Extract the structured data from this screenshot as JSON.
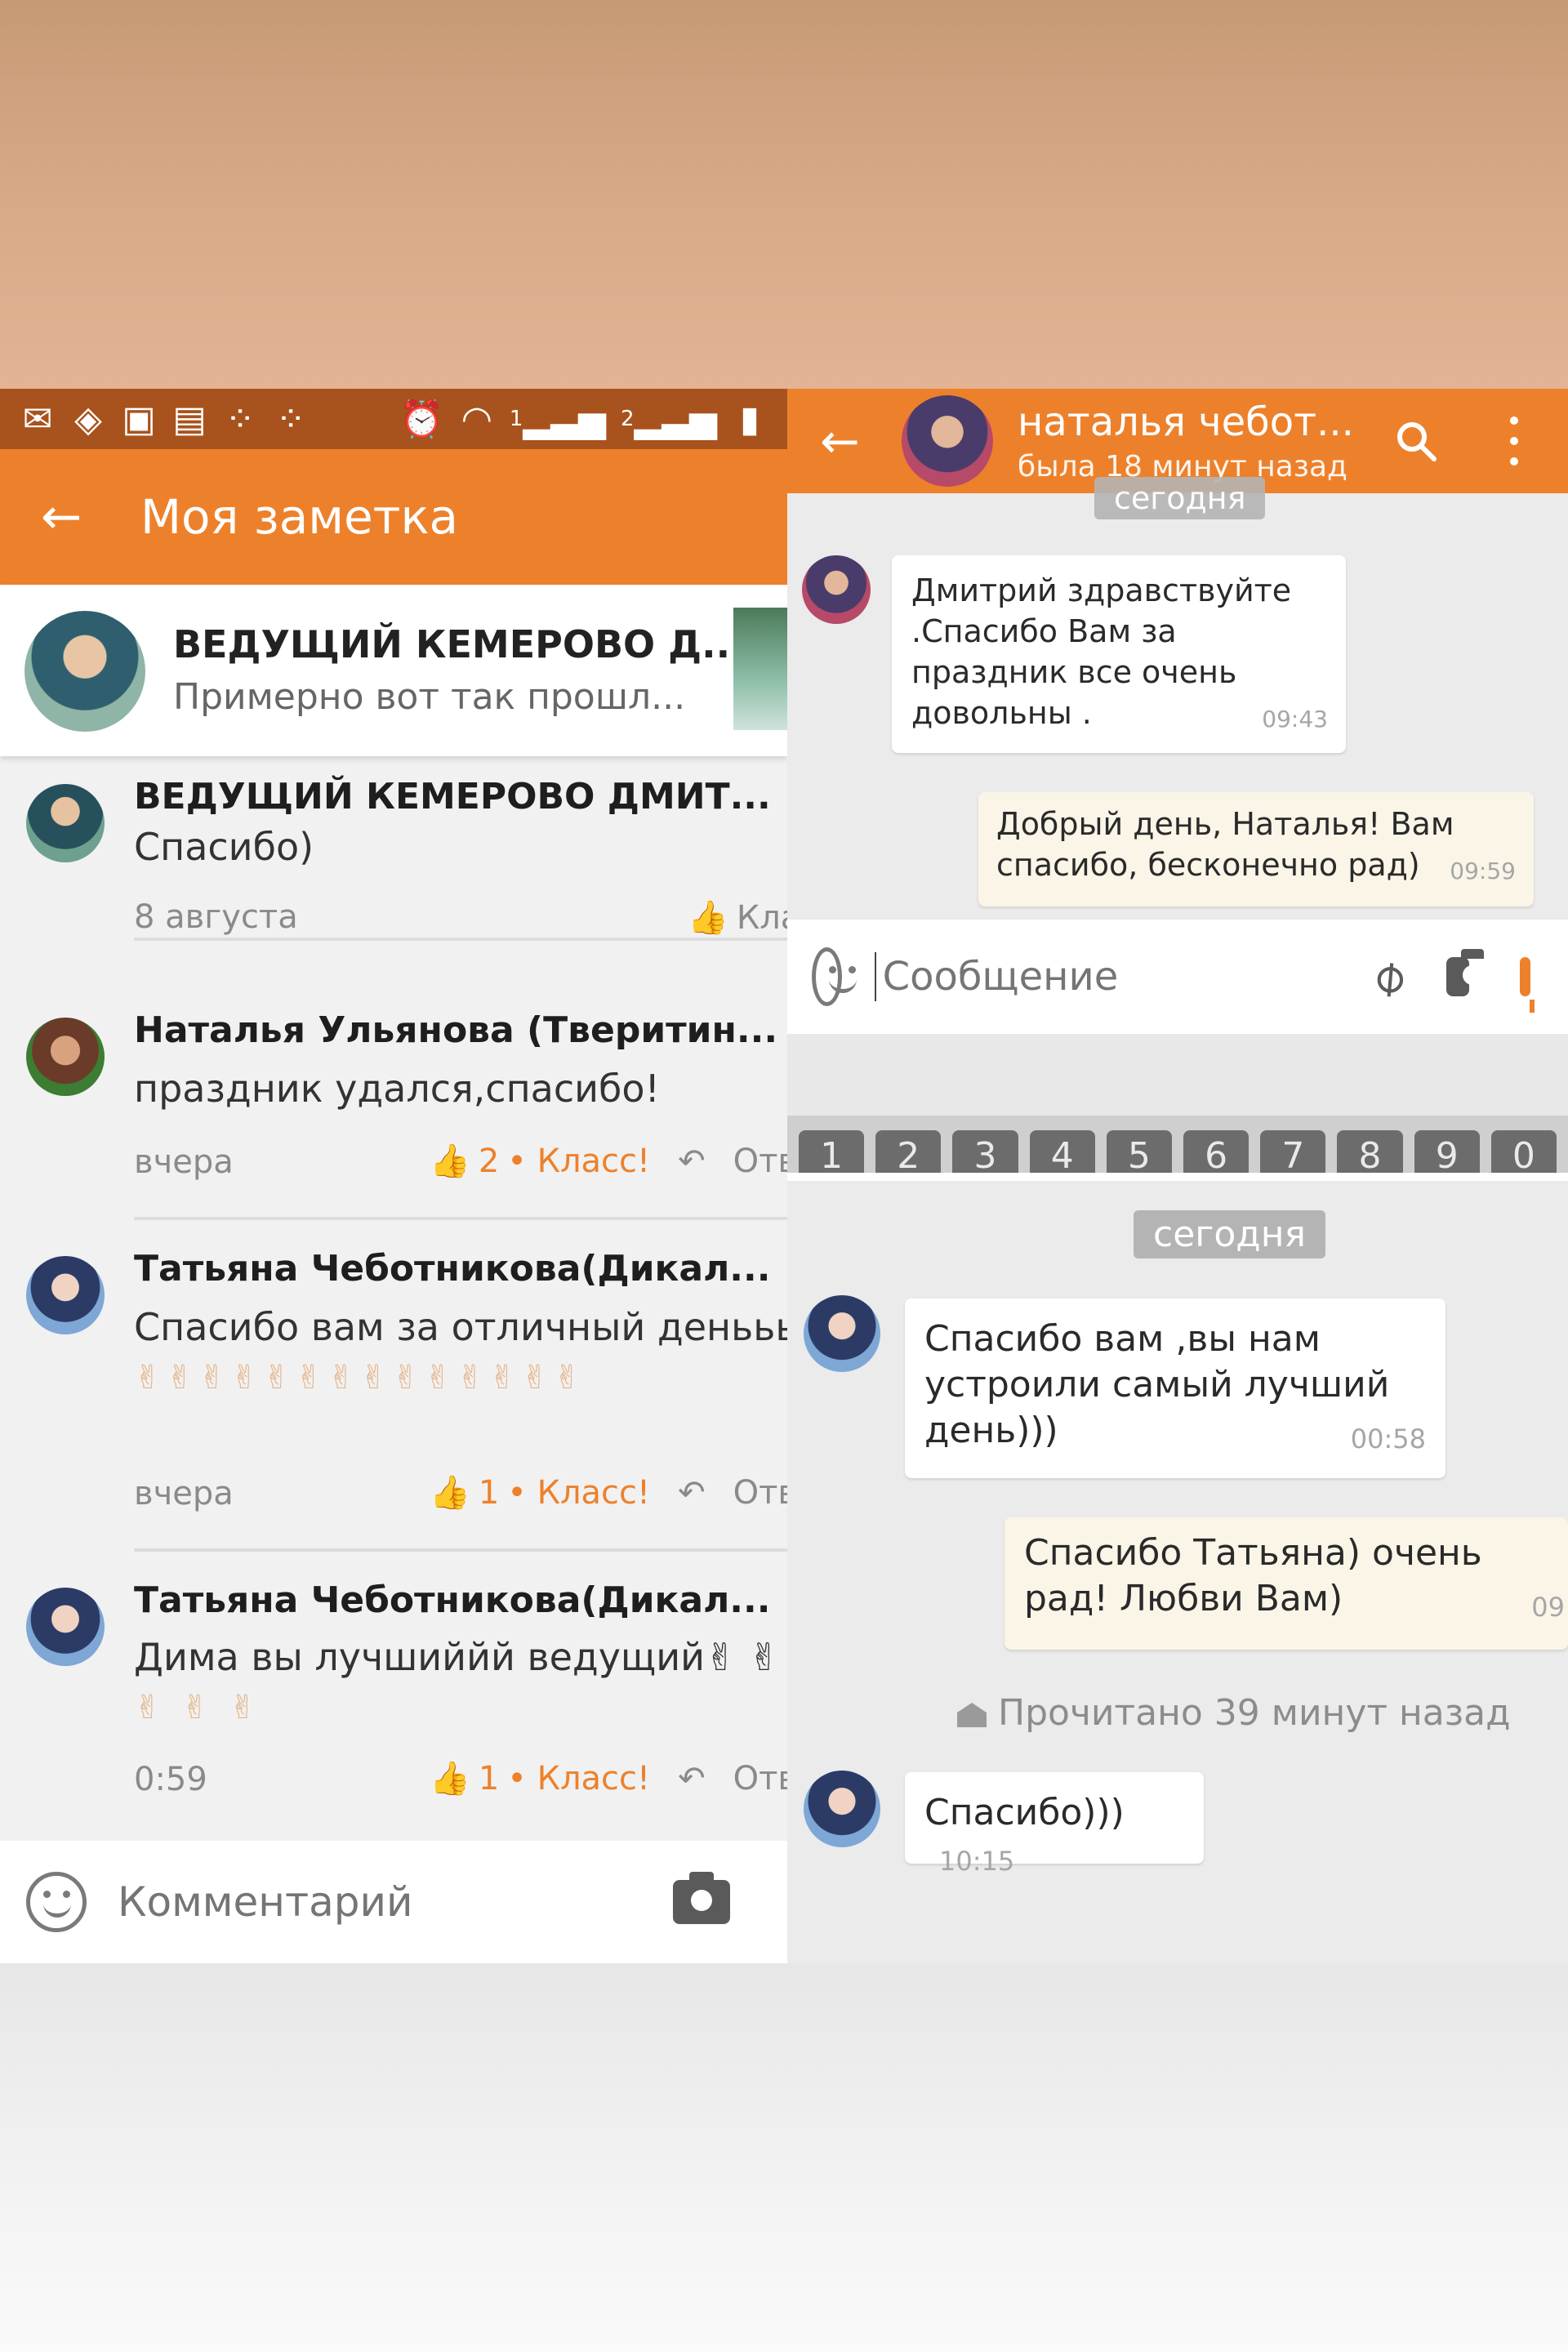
{
  "status_bar": {
    "icons_left": [
      "message-icon",
      "app-icon",
      "image-icon",
      "chat-icon",
      "grid-icon",
      "grid-icon"
    ],
    "icons_right": [
      "alarm-icon",
      "wifi-icon",
      "signal-1-icon",
      "signal-2-icon",
      "battery-icon"
    ],
    "sim1": "1",
    "sim2": "2"
  },
  "left_app": {
    "title": "Моя заметка",
    "note": {
      "author": "ВЕДУЩИЙ КЕМЕРОВО Д...",
      "preview": "Примерно вот так прошл..."
    },
    "comments": [
      {
        "name": "ВЕДУЩИЙ КЕМЕРОВО ДМИТ...",
        "text": "Спасибо)",
        "time": "8 августа",
        "klass_label": "Кла"
      },
      {
        "name": "Наталья Ульянова (Тверитин...",
        "text": "праздник удался,спасибо!",
        "time": "вчера",
        "likes": "2",
        "klass_label": "• Класс!",
        "reply_label": "Ответ"
      },
      {
        "name": "Татьяна Чеботникова(Дикал...",
        "text": "Спасибо вам за отличный деньььь",
        "emoji": "✌✌✌✌✌✌✌✌✌✌✌✌✌✌",
        "time": "вчера",
        "likes": "1",
        "klass_label": "• Класс!",
        "reply_label": "Ответ"
      },
      {
        "name": "Татьяна Чеботникова(Дикал...",
        "text": "Дима вы лучшиййй ведущий✌ ✌",
        "emoji": "✌ ✌ ✌",
        "time": "0:59",
        "likes": "1",
        "klass_label": "• Класс!",
        "reply_label": "Ответ"
      }
    ],
    "comment_placeholder": "Комментарий"
  },
  "right_chat_top": {
    "name": "наталья чебот...",
    "last_seen": "была 18 минут назад",
    "date_label": "сегодня",
    "messages": [
      {
        "direction": "in",
        "text": "Дмитрий здравствуйте .Спасибо Вам за праздник все очень довольны .",
        "time": "09:43"
      },
      {
        "direction": "out",
        "text": "Добрый день, Наталья! Вам спасибо, бесконечно рад)",
        "time": "09:59"
      }
    ],
    "input_placeholder": "Сообщение",
    "keyboard_keys": [
      "1",
      "2",
      "3",
      "4",
      "5",
      "6",
      "7",
      "8",
      "9",
      "0"
    ]
  },
  "right_chat_bottom": {
    "date_label": "сегодня",
    "messages": [
      {
        "direction": "in",
        "text": "Спасибо вам ,вы нам устроили самый лучший день)))",
        "time": "00:58"
      },
      {
        "direction": "out",
        "text": "Спасибо Татьяна) очень рад! Любви Вам)",
        "time": "09"
      },
      {
        "direction": "in",
        "text": "Спасибо)))",
        "time": "10:15"
      }
    ],
    "read_status": "Прочитано 39 минут назад"
  },
  "colors": {
    "accent_orange": "#ed812b",
    "status_bar": "#a8531d",
    "chat_bg": "#ebebeb",
    "out_bubble": "#fbf5e8"
  }
}
